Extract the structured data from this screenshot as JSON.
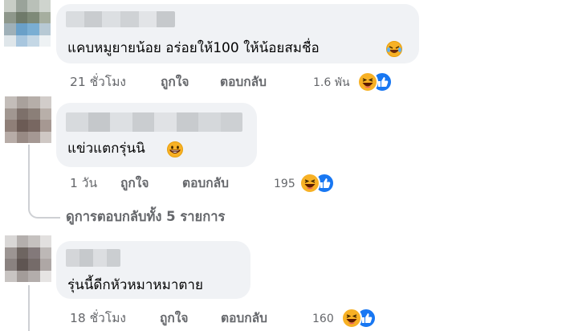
{
  "comments": [
    {
      "text": "แคบหมูยายน้อย อร่อยให้100 ให้น้อยสมชื่อ",
      "time": "21 ชั่วโมง",
      "like_label": "ถูกใจ",
      "reply_label": "ตอบกลับ",
      "reaction_count": "1.6 พัน",
      "inline_emoji": "rolling-laughing-emoji",
      "reactions": [
        "haha-reaction-icon",
        "like-reaction-icon"
      ]
    },
    {
      "text": "แข่วแตกรุ่นนิ",
      "time": "1 วัน",
      "like_label": "ถูกใจ",
      "reply_label": "ตอบกลับ",
      "reaction_count": "195",
      "inline_emoji": "grinning-emoji",
      "reactions": [
        "haha-reaction-icon",
        "like-reaction-icon"
      ],
      "view_replies": "ดูการตอบกลับทั้ง 5 รายการ"
    },
    {
      "text": "รุ่นนี้ดีกหัวหมาหมาตาย",
      "time": "18 ชั่วโมง",
      "like_label": "ถูกใจ",
      "reply_label": "ตอบกลับ",
      "reaction_count": "160",
      "reactions": [
        "haha-reaction-icon",
        "like-reaction-icon"
      ]
    }
  ],
  "colors": {
    "bubble": "#f0f2f5",
    "meta_text": "#65676b",
    "like_blue": "#1877f2",
    "haha_yellow": "#f7b125"
  }
}
